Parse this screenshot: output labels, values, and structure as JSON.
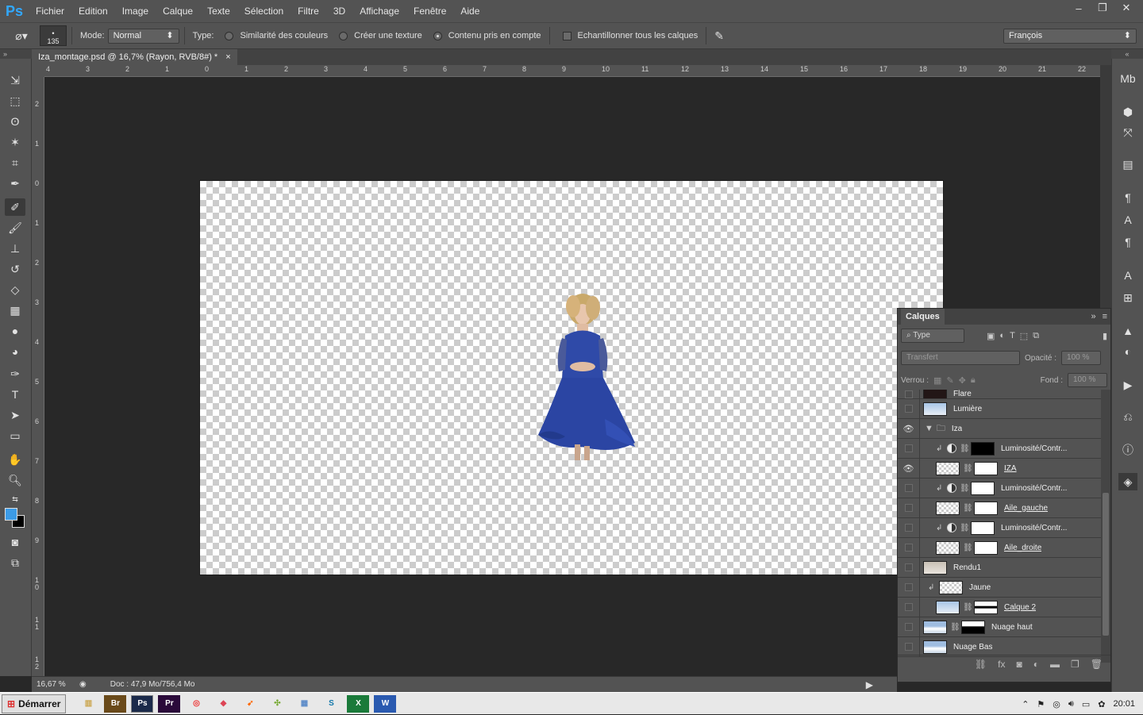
{
  "app": {
    "logo": "Ps"
  },
  "menu": [
    "Fichier",
    "Edition",
    "Image",
    "Calque",
    "Texte",
    "Sélection",
    "Filtre",
    "3D",
    "Affichage",
    "Fenêtre",
    "Aide"
  ],
  "window_controls": {
    "minimize": "–",
    "restore": "❐",
    "close": "✕"
  },
  "options": {
    "brush_size": "135",
    "mode_label": "Mode:",
    "mode_value": "Normal",
    "type_label": "Type:",
    "type_options": [
      "Similarité des couleurs",
      "Créer une texture",
      "Contenu pris en compte"
    ],
    "type_selected": "Contenu pris en compte",
    "sample_all": "Echantillonner tous les calques",
    "language": "François"
  },
  "document": {
    "tab_title": "Iza_montage.psd @ 16,7% (Rayon, RVB/8#) *",
    "tab_close": "×"
  },
  "rulers": {
    "h": [
      "4",
      "3",
      "2",
      "1",
      "0",
      "1",
      "2",
      "3",
      "4",
      "5",
      "6",
      "7",
      "8",
      "9",
      "10",
      "11",
      "12",
      "13",
      "14",
      "15",
      "16",
      "17",
      "18",
      "19",
      "20",
      "21",
      "22"
    ],
    "v": [
      "2",
      "1",
      "0",
      "1",
      "2",
      "3",
      "4",
      "5",
      "6",
      "7",
      "8",
      "9",
      "1 0",
      "1 1",
      "1 2"
    ]
  },
  "status": {
    "zoom": "16,67 %",
    "doc": "Doc : 47,9 Mo/756,4 Mo"
  },
  "layers_panel": {
    "title": "Calques",
    "filter": "Type",
    "blend": "Transfert",
    "opacity_label": "Opacité :",
    "opacity": "100 %",
    "lock_label": "Verrou :",
    "fill_label": "Fond :",
    "fill": "100 %",
    "layers": [
      {
        "name": "Flare",
        "visible": false,
        "thumb": "darkfill"
      },
      {
        "name": "Lumière",
        "visible": false,
        "thumb": "sky"
      },
      {
        "name": "Iza",
        "visible": true,
        "group": true
      },
      {
        "name": "Luminosité/Contr...",
        "visible": false,
        "adjust": true,
        "mask": "mask-black"
      },
      {
        "name": "IZA",
        "visible": true,
        "thumb": "checker",
        "mask": "mask-white",
        "underline": true
      },
      {
        "name": "Luminosité/Contr...",
        "visible": false,
        "adjust": true,
        "mask": "mask-white"
      },
      {
        "name": "Aile_gauche",
        "visible": false,
        "thumb": "checker",
        "mask": "mask-white",
        "underline": true
      },
      {
        "name": "Luminosité/Contr...",
        "visible": false,
        "adjust": true,
        "mask": "mask-white"
      },
      {
        "name": "Aile_droite",
        "visible": false,
        "thumb": "checker",
        "mask": "mask-white",
        "underline": true
      },
      {
        "name": "Rendu1",
        "visible": false,
        "thumb": "render"
      },
      {
        "name": "Jaune",
        "visible": false,
        "thumb": "checker",
        "clipped": true
      },
      {
        "name": "Calque 2",
        "visible": false,
        "thumb": "sky",
        "mask": "mask-clouds",
        "underline": true
      },
      {
        "name": "Nuage haut",
        "visible": false,
        "thumb": "cloud",
        "mask": "mask-cloud2"
      },
      {
        "name": "Nuage Bas",
        "visible": false,
        "thumb": "cloud"
      }
    ]
  },
  "taskbar": {
    "start": "Démarrer",
    "apps": [
      "Explorer",
      "Br",
      "Ps",
      "Pr",
      "Chrome",
      "App",
      "App",
      "App",
      "Calc",
      "Skype",
      "X",
      "W"
    ],
    "time": "20:01"
  },
  "colors": {
    "accent": "#31a8ff",
    "foreground": "#3c9be6",
    "background": "#000000"
  }
}
